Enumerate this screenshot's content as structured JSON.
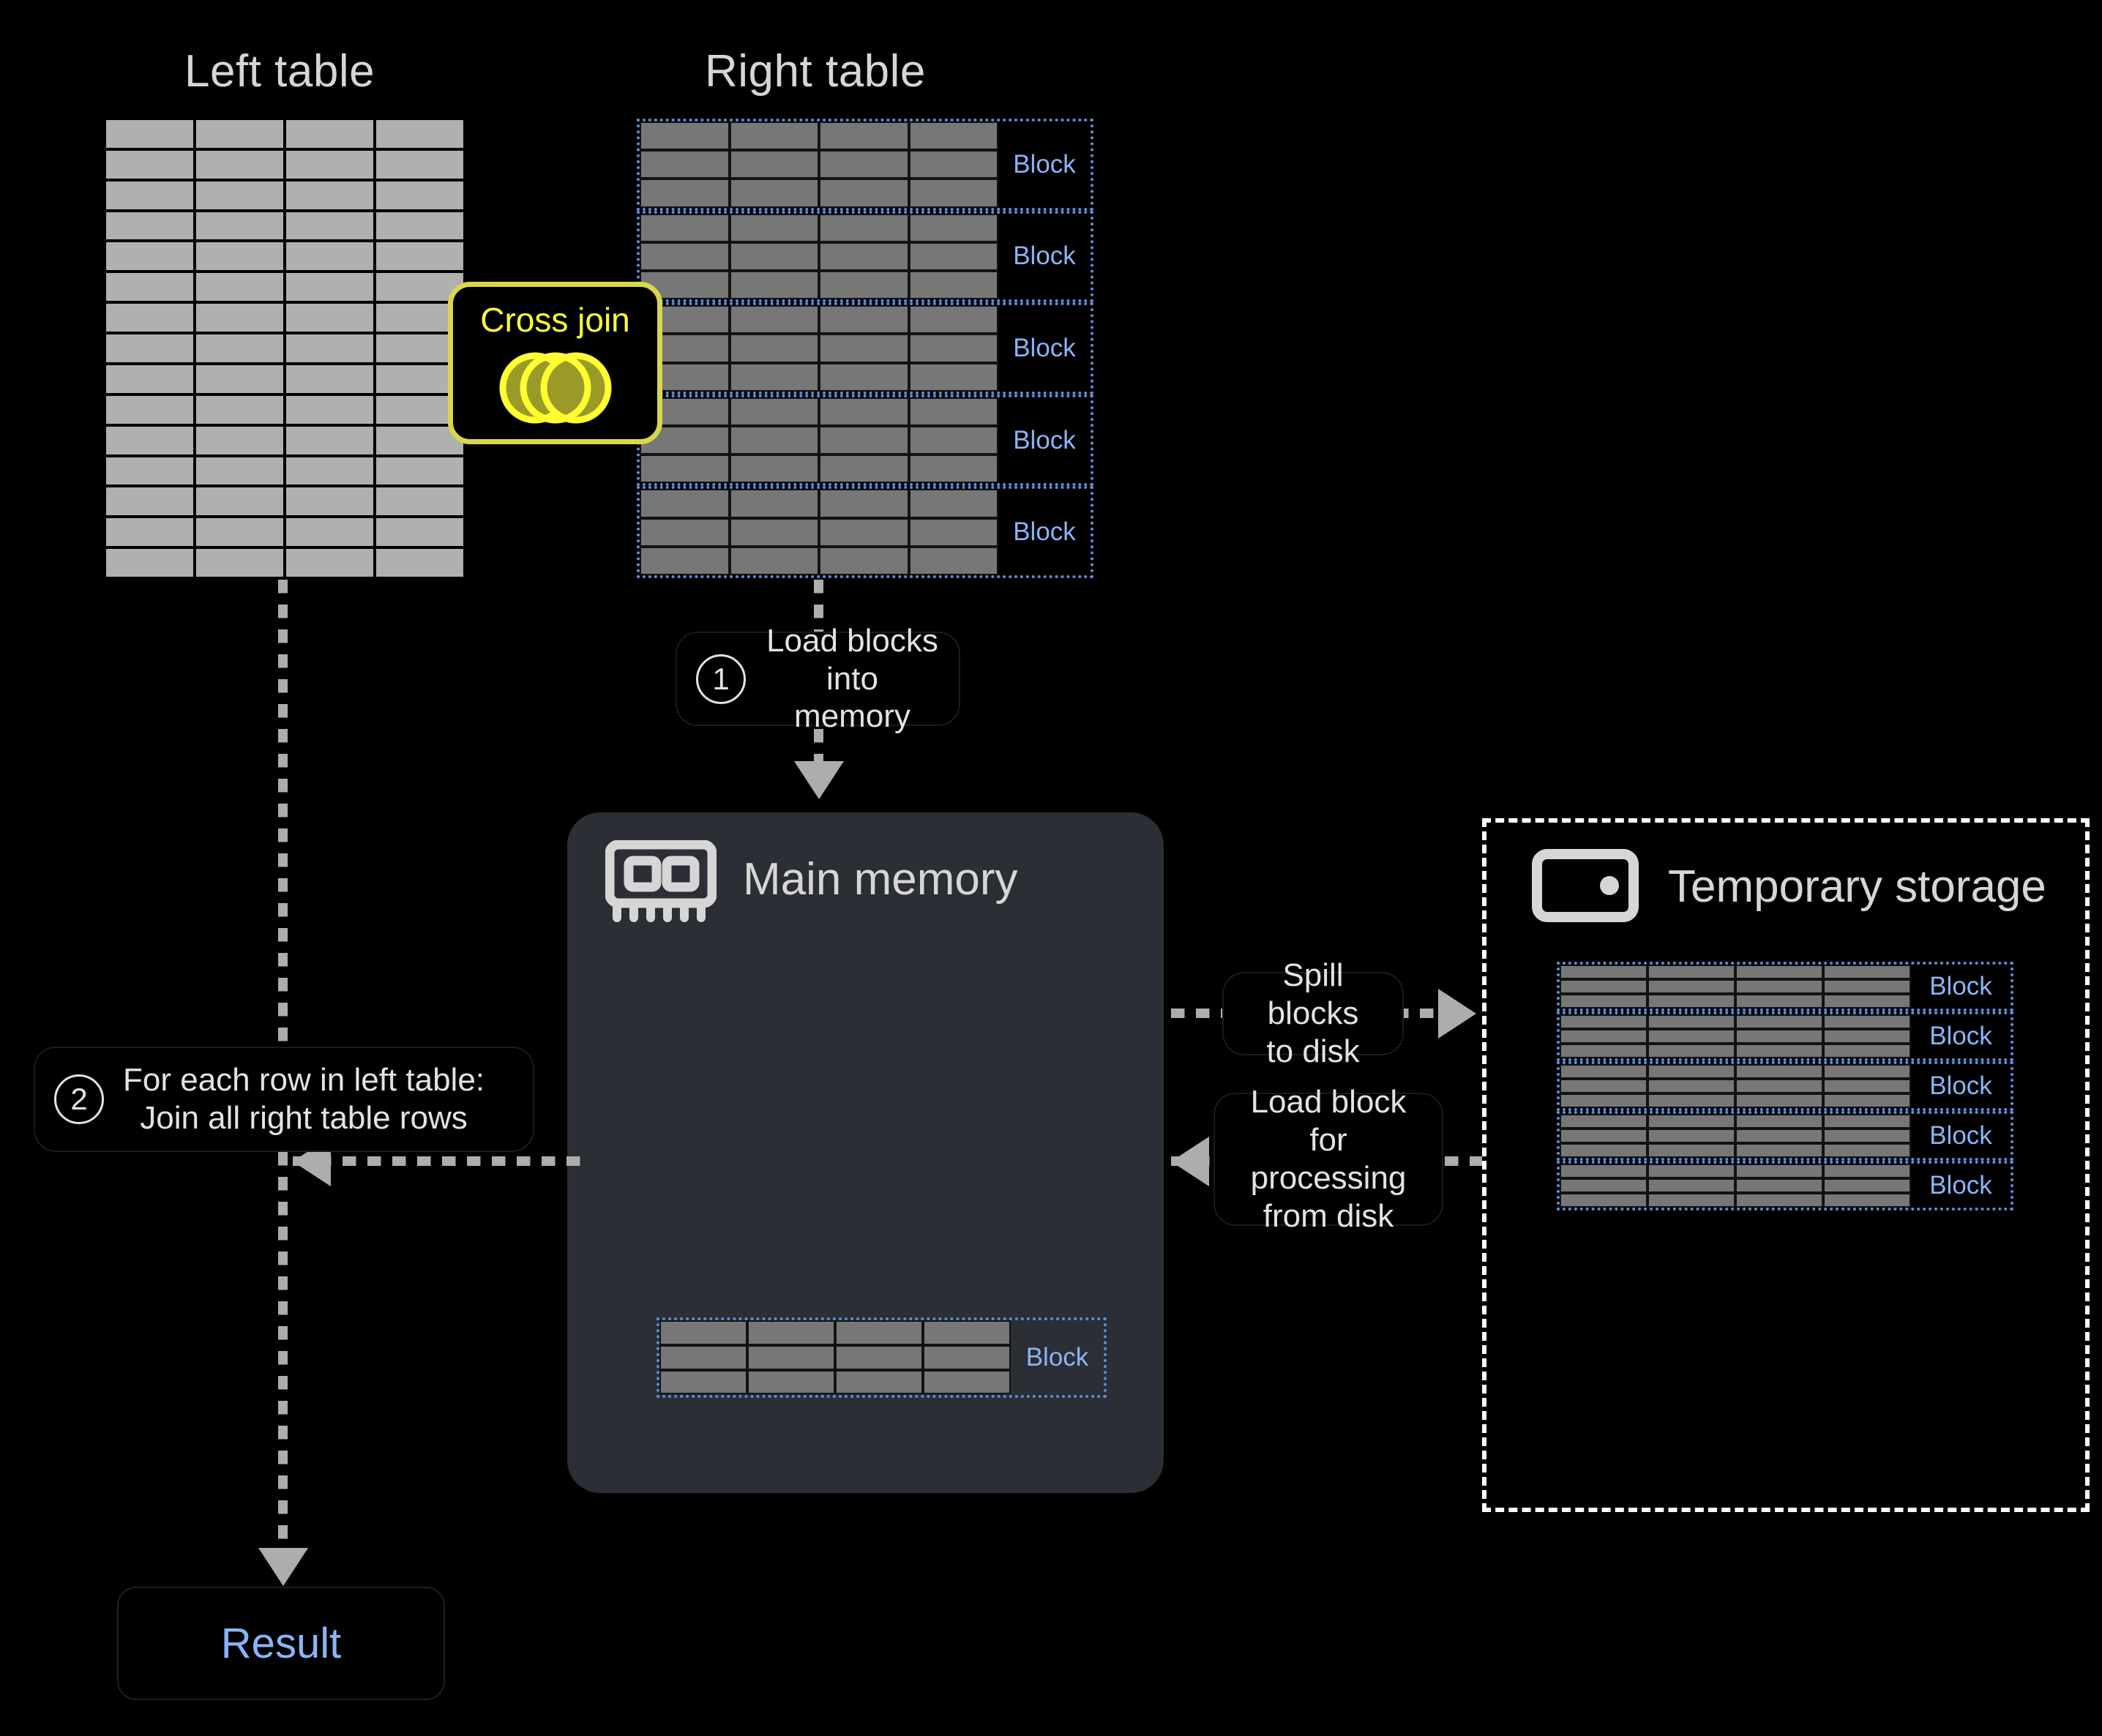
{
  "titles": {
    "left_table": "Left table",
    "right_table": "Right table"
  },
  "cross_join": {
    "label": "Cross join",
    "icon": "venn-two-circles-icon",
    "border_color": "#d8d84a",
    "text_color": "#ffff32",
    "circle_fill": "#9a9a26",
    "circle_stroke": "#ffff32"
  },
  "block_label": "Block",
  "block_label_color": "#8ab4f8",
  "block_border_color": "#5b8fdd",
  "left_table": {
    "rows": 15,
    "cols": 4,
    "cell_color": "#b0b0b0"
  },
  "right_table": {
    "blocks": 5,
    "rows_per_block": 3,
    "cols": 4,
    "cell_color": "#777777"
  },
  "main_memory": {
    "title": "Main memory",
    "icon": "memory-stick-icon",
    "panel_color": "#2b2e34",
    "blocks": 1,
    "rows_per_block": 3,
    "cols": 4
  },
  "temporary_storage": {
    "title": "Temporary storage",
    "icon": "hard-disk-icon",
    "border_style": "dashed white",
    "blocks": 5,
    "rows_per_block": 3,
    "cols": 4
  },
  "steps": [
    {
      "number": "1",
      "text": "Load blocks\ninto memory"
    },
    {
      "number": "2",
      "text": "For each row in left table:\nJoin all right table rows"
    }
  ],
  "arrow_labels": {
    "spill": "Spill blocks\nto disk",
    "load_back": "Load block\nfor processing\nfrom disk"
  },
  "result": {
    "label": "Result",
    "text_color": "#8ab4f8"
  }
}
